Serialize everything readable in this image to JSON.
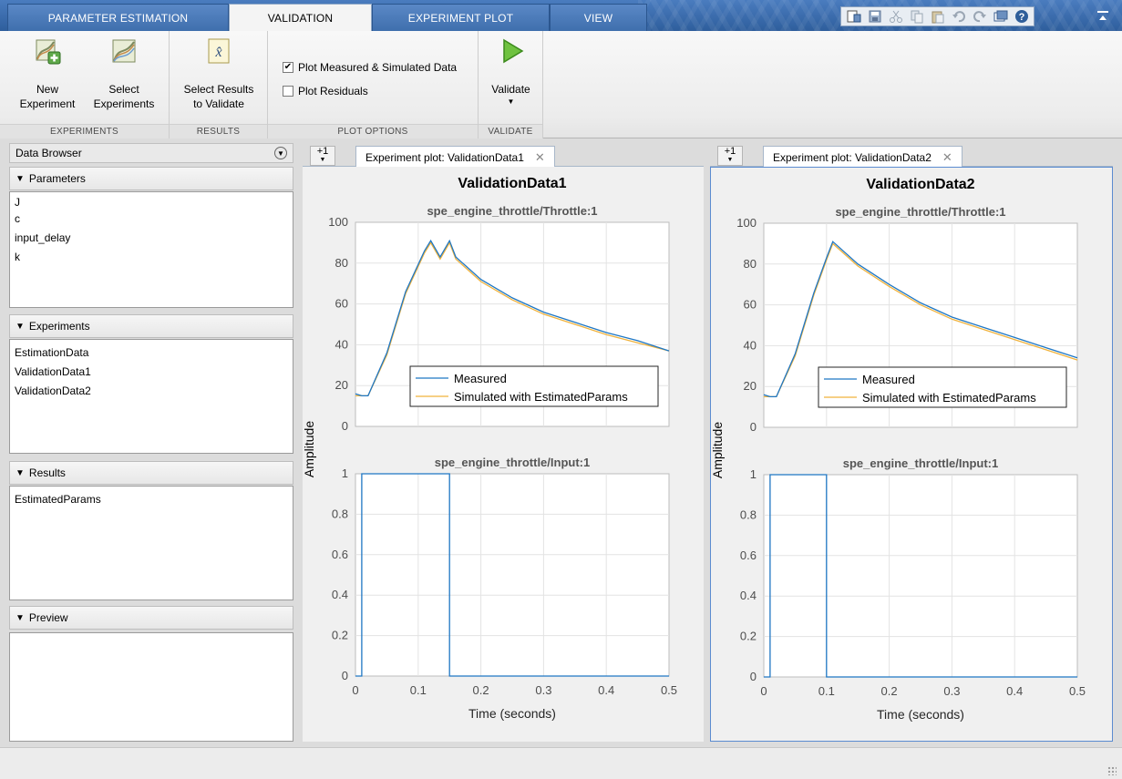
{
  "tabs": [
    {
      "label": "PARAMETER ESTIMATION",
      "active": false
    },
    {
      "label": "VALIDATION",
      "active": true
    },
    {
      "label": "EXPERIMENT PLOT",
      "active": false
    },
    {
      "label": "VIEW",
      "active": false
    }
  ],
  "ribbon": {
    "experiments": {
      "group_label": "EXPERIMENTS",
      "new_label_1": "New",
      "new_label_2": "Experiment",
      "select_label_1": "Select",
      "select_label_2": "Experiments"
    },
    "results": {
      "group_label": "RESULTS",
      "select_label_1": "Select Results",
      "select_label_2": "to Validate"
    },
    "plot_options": {
      "group_label": "PLOT OPTIONS",
      "measured_sim_label": "Plot Measured & Simulated Data",
      "measured_sim_checked": true,
      "residuals_label": "Plot Residuals",
      "residuals_checked": false
    },
    "validate": {
      "group_label": "VALIDATE",
      "button_label": "Validate"
    }
  },
  "data_browser": {
    "title": "Data Browser",
    "parameters": {
      "title": "Parameters",
      "items": [
        "J",
        "c",
        "input_delay",
        "k"
      ]
    },
    "experiments": {
      "title": "Experiments",
      "items": [
        "EstimationData",
        "ValidationData1",
        "ValidationData2"
      ]
    },
    "results": {
      "title": "Results",
      "items": [
        "EstimatedParams"
      ]
    },
    "preview": {
      "title": "Preview"
    }
  },
  "documents": [
    {
      "add_label": "+1",
      "tab_label": "Experiment plot: ValidationData1",
      "close_glyph": "✕"
    },
    {
      "add_label": "+1",
      "tab_label": "Experiment plot: ValidationData2",
      "close_glyph": "✕"
    }
  ],
  "colors": {
    "measured": "#1f77c4",
    "simulated": "#f0b23c",
    "tab_blue": "#3a6aa8"
  },
  "chart_data": [
    {
      "type": "line",
      "title": "ValidationData1",
      "ylabel": "Amplitude",
      "xlabel": "Time (seconds)",
      "subplots": [
        {
          "subtitle": "spe_engine_throttle/Throttle:1",
          "ylim": [
            0,
            100
          ],
          "yticks": [
            "0",
            "20",
            "40",
            "60",
            "80",
            "100"
          ],
          "xlim": [
            0,
            0.5
          ],
          "grid": true,
          "legend": {
            "placement": "lower-right",
            "entries": [
              "Measured",
              "Simulated with EstimatedParams"
            ]
          },
          "series": [
            {
              "name": "Measured",
              "x": [
                0,
                0.01,
                0.02,
                0.05,
                0.08,
                0.11,
                0.12,
                0.135,
                0.15,
                0.16,
                0.2,
                0.25,
                0.3,
                0.35,
                0.4,
                0.45,
                0.5
              ],
              "y": [
                16,
                15,
                15,
                36,
                66,
                86,
                91,
                83,
                91,
                83,
                72,
                63,
                56,
                51,
                46,
                42,
                37
              ]
            },
            {
              "name": "Simulated with EstimatedParams",
              "x": [
                0,
                0.01,
                0.02,
                0.05,
                0.08,
                0.11,
                0.12,
                0.135,
                0.15,
                0.16,
                0.2,
                0.25,
                0.3,
                0.35,
                0.4,
                0.45,
                0.5
              ],
              "y": [
                15,
                15,
                15,
                35,
                65,
                85,
                90,
                82,
                90,
                82,
                71,
                62,
                55,
                50,
                45,
                41,
                37
              ]
            }
          ]
        },
        {
          "subtitle": "spe_engine_throttle/Input:1",
          "ylim": [
            0,
            1
          ],
          "yticks": [
            "0",
            "0.2",
            "0.4",
            "0.6",
            "0.8",
            "1"
          ],
          "xlim": [
            0,
            0.5
          ],
          "xticks": [
            "0",
            "0.1",
            "0.2",
            "0.3",
            "0.4",
            "0.5"
          ],
          "grid": true,
          "series": [
            {
              "name": "Input",
              "x": [
                0,
                0.01,
                0.01,
                0.15,
                0.15,
                0.5
              ],
              "y": [
                0,
                0,
                1,
                1,
                0,
                0
              ]
            }
          ]
        }
      ]
    },
    {
      "type": "line",
      "title": "ValidationData2",
      "ylabel": "Amplitude",
      "xlabel": "Time (seconds)",
      "subplots": [
        {
          "subtitle": "spe_engine_throttle/Throttle:1",
          "ylim": [
            0,
            100
          ],
          "yticks": [
            "0",
            "20",
            "40",
            "60",
            "80",
            "100"
          ],
          "xlim": [
            0,
            0.5
          ],
          "grid": true,
          "legend": {
            "placement": "lower-right",
            "entries": [
              "Measured",
              "Simulated with EstimatedParams"
            ]
          },
          "series": [
            {
              "name": "Measured",
              "x": [
                0,
                0.01,
                0.02,
                0.05,
                0.08,
                0.1,
                0.11,
                0.15,
                0.2,
                0.25,
                0.3,
                0.35,
                0.4,
                0.45,
                0.5
              ],
              "y": [
                16,
                15,
                15,
                36,
                66,
                83,
                91,
                80,
                70,
                61,
                54,
                49,
                44,
                39,
                34
              ]
            },
            {
              "name": "Simulated with EstimatedParams",
              "x": [
                0,
                0.01,
                0.02,
                0.05,
                0.08,
                0.1,
                0.11,
                0.15,
                0.2,
                0.25,
                0.3,
                0.35,
                0.4,
                0.45,
                0.5
              ],
              "y": [
                15,
                15,
                15,
                35,
                65,
                82,
                90,
                79,
                69,
                60,
                53,
                48,
                43,
                38,
                33
              ]
            }
          ]
        },
        {
          "subtitle": "spe_engine_throttle/Input:1",
          "ylim": [
            0,
            1
          ],
          "yticks": [
            "0",
            "0.2",
            "0.4",
            "0.6",
            "0.8",
            "1"
          ],
          "xlim": [
            0,
            0.5
          ],
          "xticks": [
            "0",
            "0.1",
            "0.2",
            "0.3",
            "0.4",
            "0.5"
          ],
          "grid": true,
          "series": [
            {
              "name": "Input",
              "x": [
                0,
                0.01,
                0.01,
                0.1,
                0.1,
                0.5
              ],
              "y": [
                0,
                0,
                1,
                1,
                0,
                0
              ]
            }
          ]
        }
      ]
    }
  ]
}
